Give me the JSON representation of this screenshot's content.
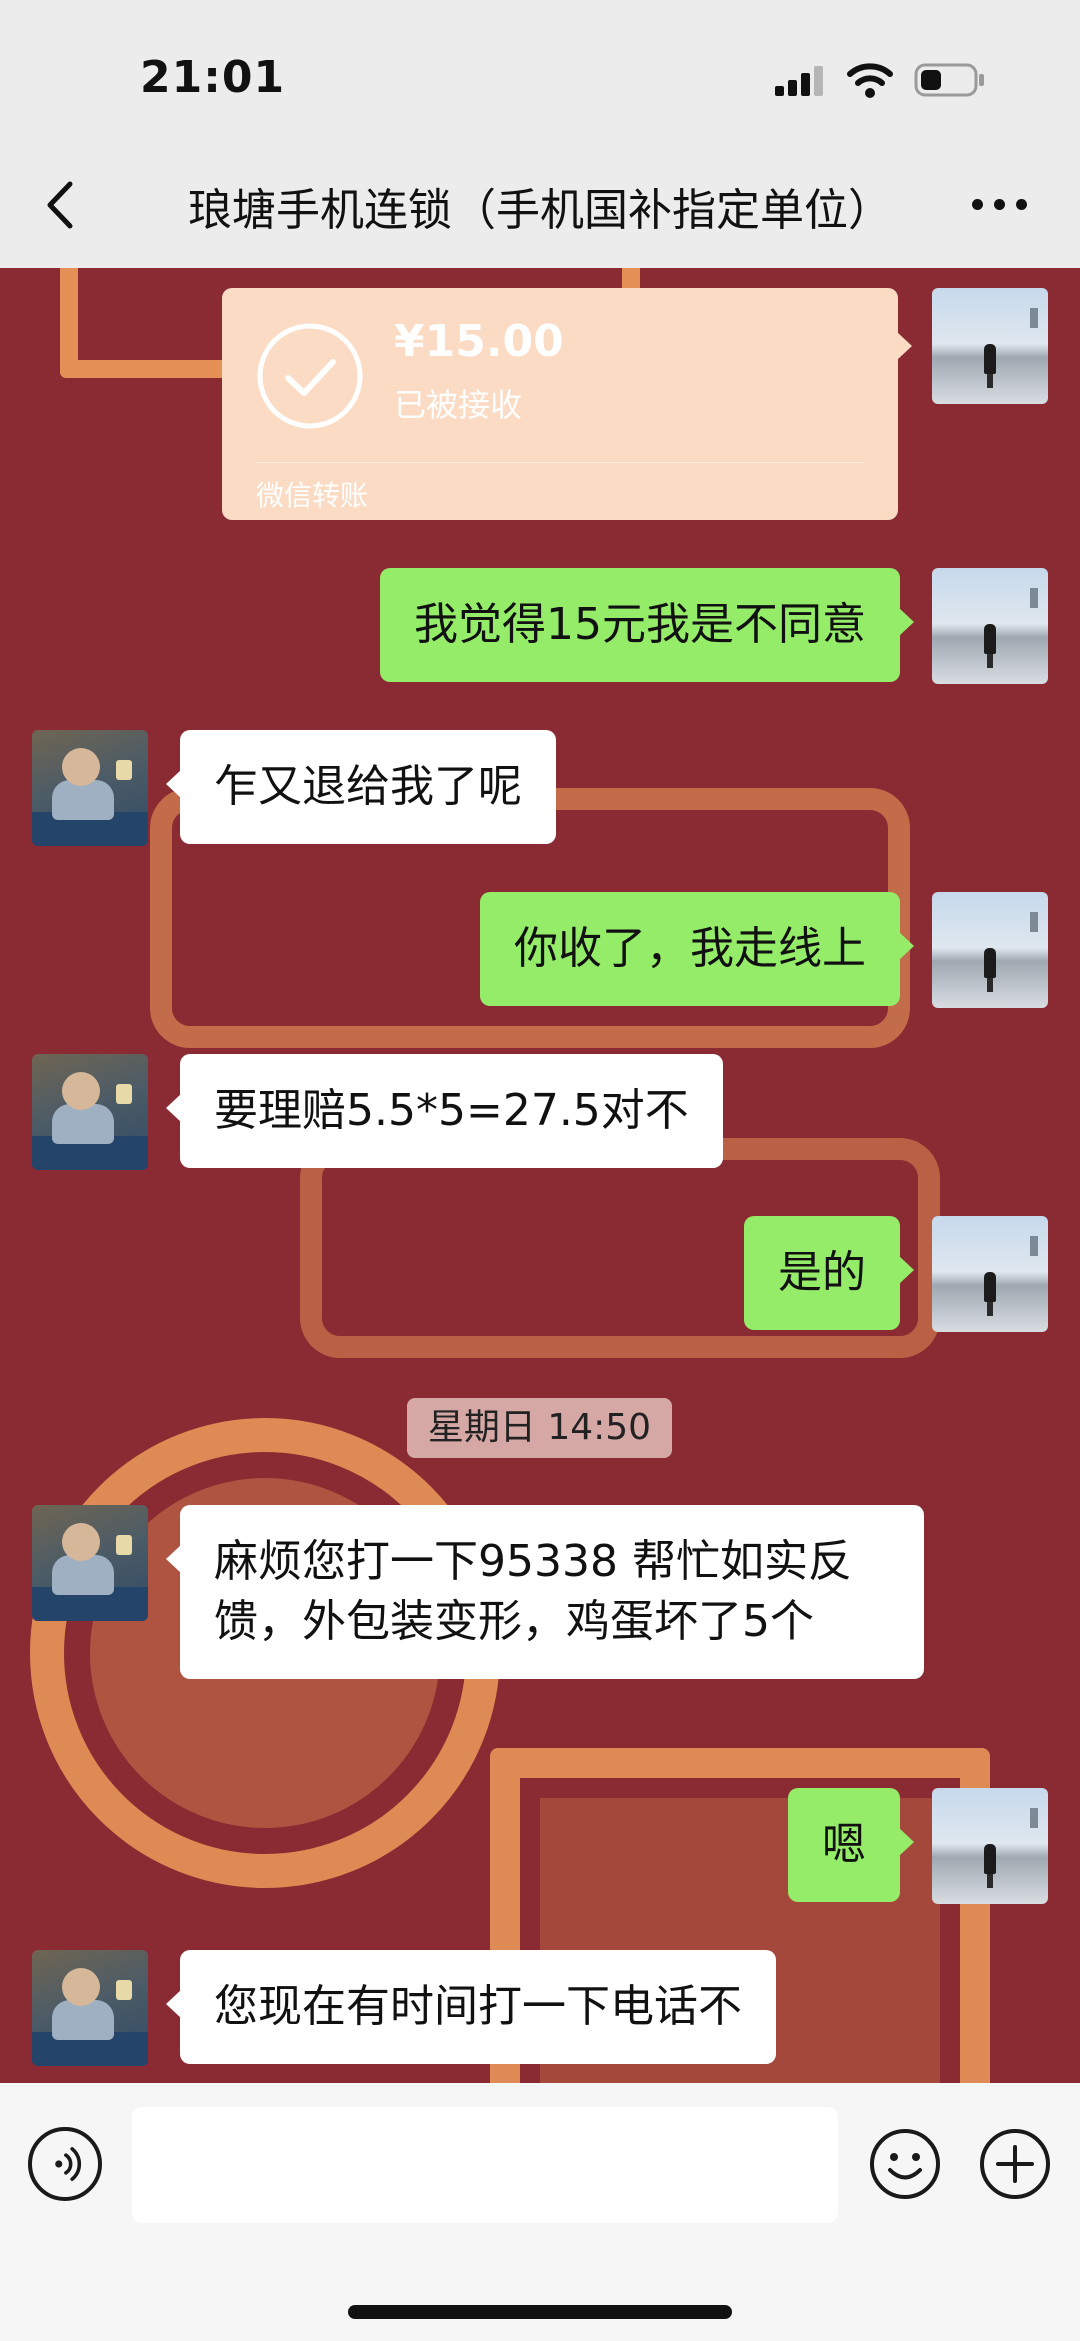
{
  "status_bar": {
    "time": "21:01"
  },
  "nav": {
    "title": "琅塘手机连锁（手机国补指定单位）"
  },
  "transfer": {
    "amount": "¥15.00",
    "status": "已被接收",
    "label": "微信转账"
  },
  "messages": [
    {
      "sender": "self",
      "text": "我觉得15元我是不同意"
    },
    {
      "sender": "other",
      "text": "乍又退给我了呢"
    },
    {
      "sender": "self",
      "text": "你收了，我走线上"
    },
    {
      "sender": "other",
      "text": "要理赔5.5*5=27.5对不"
    },
    {
      "sender": "self",
      "text": "是的"
    },
    {
      "sender": "other",
      "text": "麻烦您打一下95338  帮忙如实反馈，外包装变形，鸡蛋坏了5个"
    },
    {
      "sender": "self",
      "text": "嗯"
    },
    {
      "sender": "other",
      "text": "您现在有时间打一下电话不"
    }
  ],
  "timestamp": "星期日 14:50",
  "input": {
    "placeholder": ""
  },
  "icons": {
    "back": "chevron-left-icon",
    "more": "more-horizontal-icon",
    "voice": "voice-icon",
    "emoji": "emoji-icon",
    "plus": "plus-icon",
    "transfer": "check-circle-icon"
  },
  "colors": {
    "self_bubble": "#95ec69",
    "other_bubble": "#ffffff",
    "transfer_card": "#fbdbc3",
    "chat_background": "#8a2a32",
    "background_art": "#f3a25d"
  }
}
